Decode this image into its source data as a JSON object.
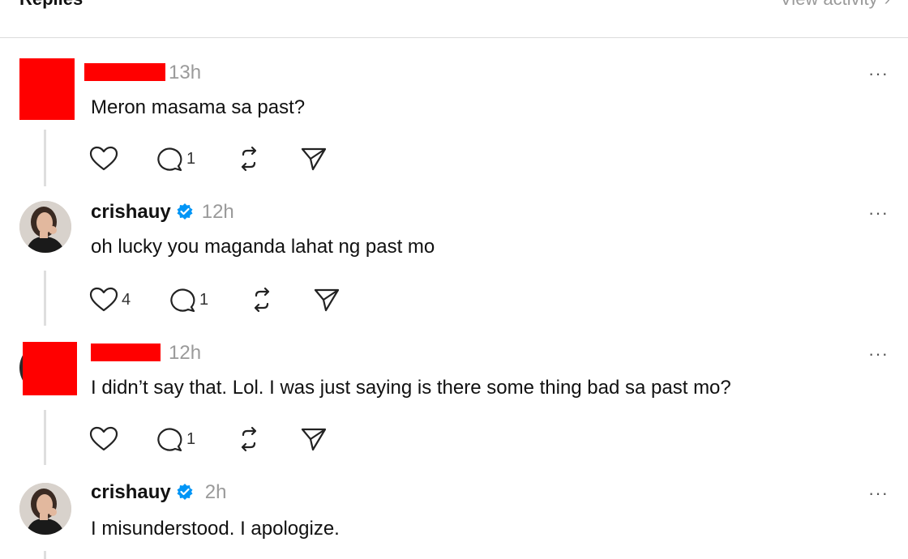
{
  "header": {
    "title": "Replies",
    "link": "View activity",
    "chevron": "›"
  },
  "posts": [
    {
      "username": "",
      "time": "13h",
      "text": "Meron masama sa past?",
      "more": "···",
      "likes": "",
      "replies": "1",
      "reposts": "",
      "avatar": "redacted"
    },
    {
      "username": "crishauy",
      "verified": true,
      "time": "12h",
      "text": "oh lucky you maganda lahat ng past mo",
      "more": "···",
      "likes": "4",
      "replies": "1",
      "reposts": "",
      "avatar": "photo"
    },
    {
      "username": "",
      "time": "12h",
      "text": "I didn’t say that. Lol. I was just saying is there some thing bad sa past mo?",
      "more": "···",
      "likes": "",
      "replies": "1",
      "reposts": "",
      "avatar": "redacted"
    },
    {
      "username": "crishauy",
      "verified": true,
      "time": "2h",
      "text": "I misunderstood. I apologize.",
      "more": "···",
      "avatar": "photo"
    }
  ],
  "colors": {
    "verified": "#0095f6",
    "redaction": "#ff0000",
    "muted": "#9a9a9a"
  },
  "icons": {
    "like": "heart-icon",
    "reply": "comment-icon",
    "repost": "repost-icon",
    "share": "send-icon",
    "verified": "verified-badge-icon"
  }
}
